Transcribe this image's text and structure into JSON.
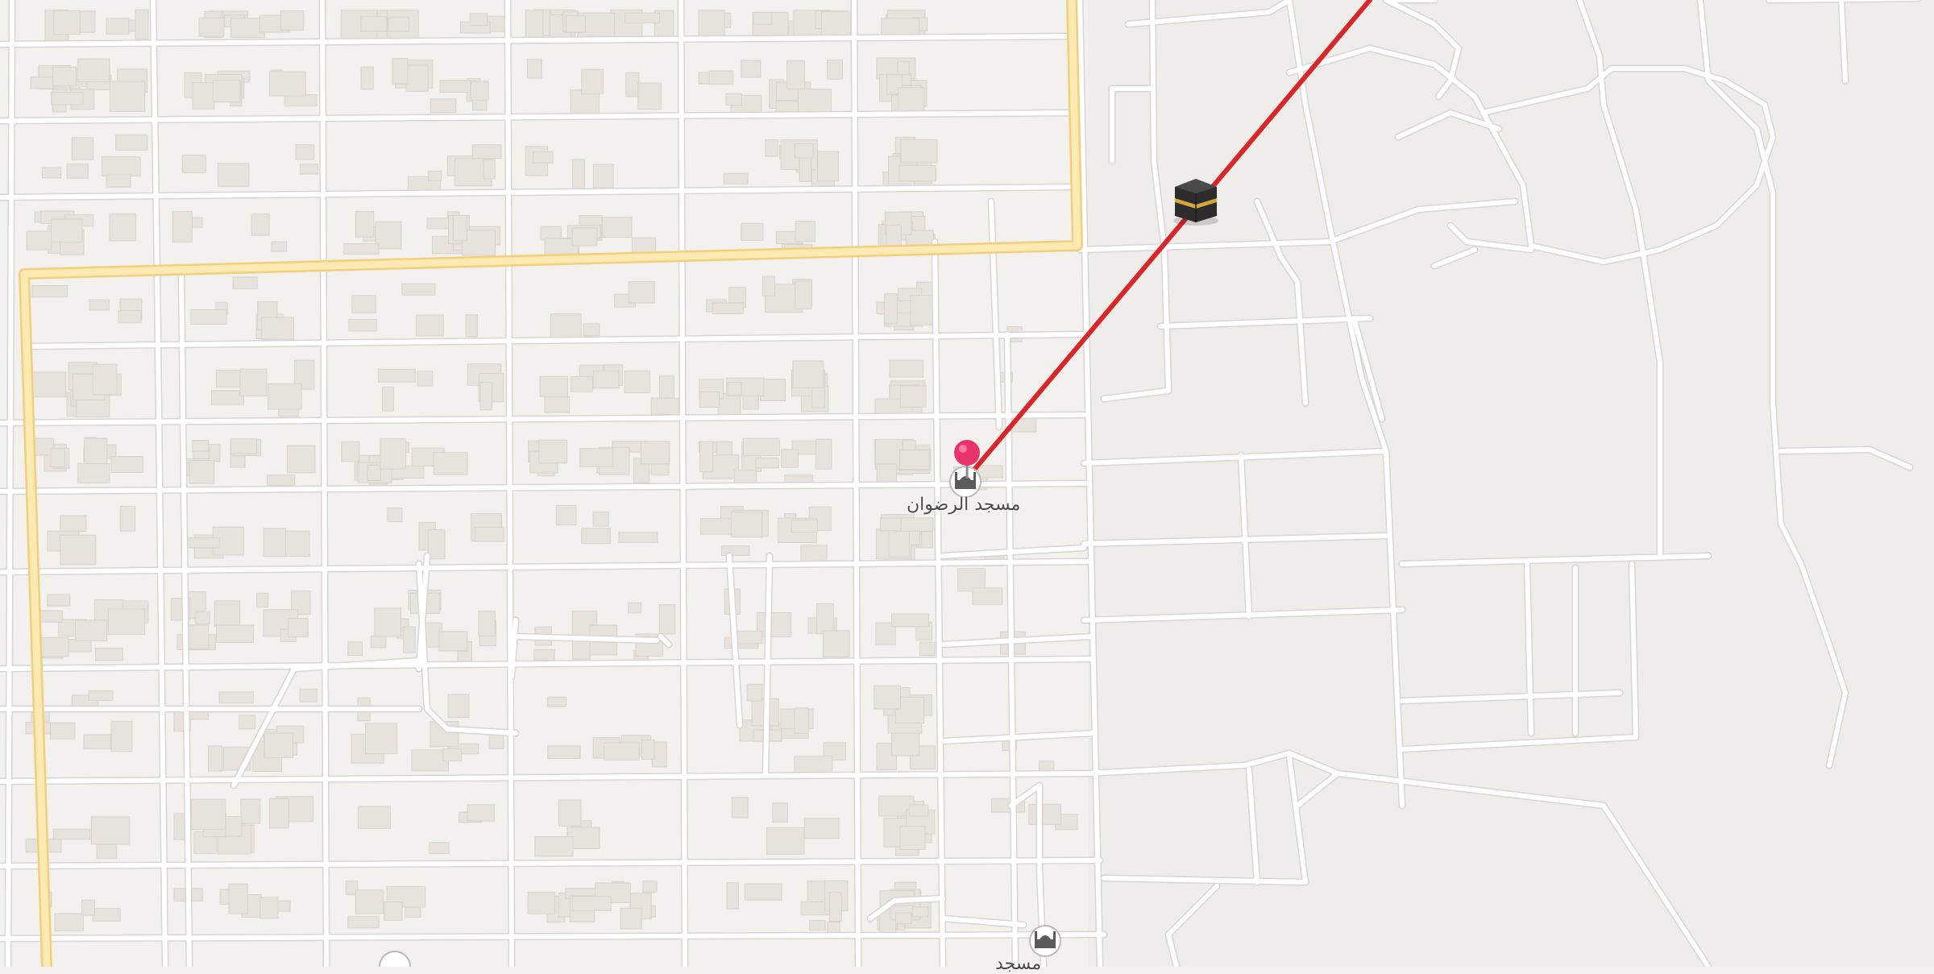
{
  "map": {
    "background_color": "#f3f1ee",
    "land_right_color": "#efedea",
    "block_color": "#eeebe7",
    "building_color": "#e7e2dc",
    "building_stroke": "#d8d2cb",
    "street_color": "#ffffff",
    "street_edge_color": "#d9d6d2",
    "arterial_color": "#fde9b2",
    "arterial_edge_color": "#f1cf7d",
    "route_line_color": "#d8262b"
  },
  "pois": [
    {
      "name": "مسجد الرضوان",
      "icon": "mosque-icon",
      "selected": true
    },
    {
      "name": "مسجد",
      "icon": "mosque-icon",
      "selected": false
    }
  ],
  "markers": {
    "selected_pin": {
      "icon": "map-pin-icon",
      "color": "#e8336b"
    },
    "qibla_target": {
      "icon": "kaaba-icon",
      "color": "#2c2c2c",
      "band_color": "#d4a63a"
    }
  }
}
